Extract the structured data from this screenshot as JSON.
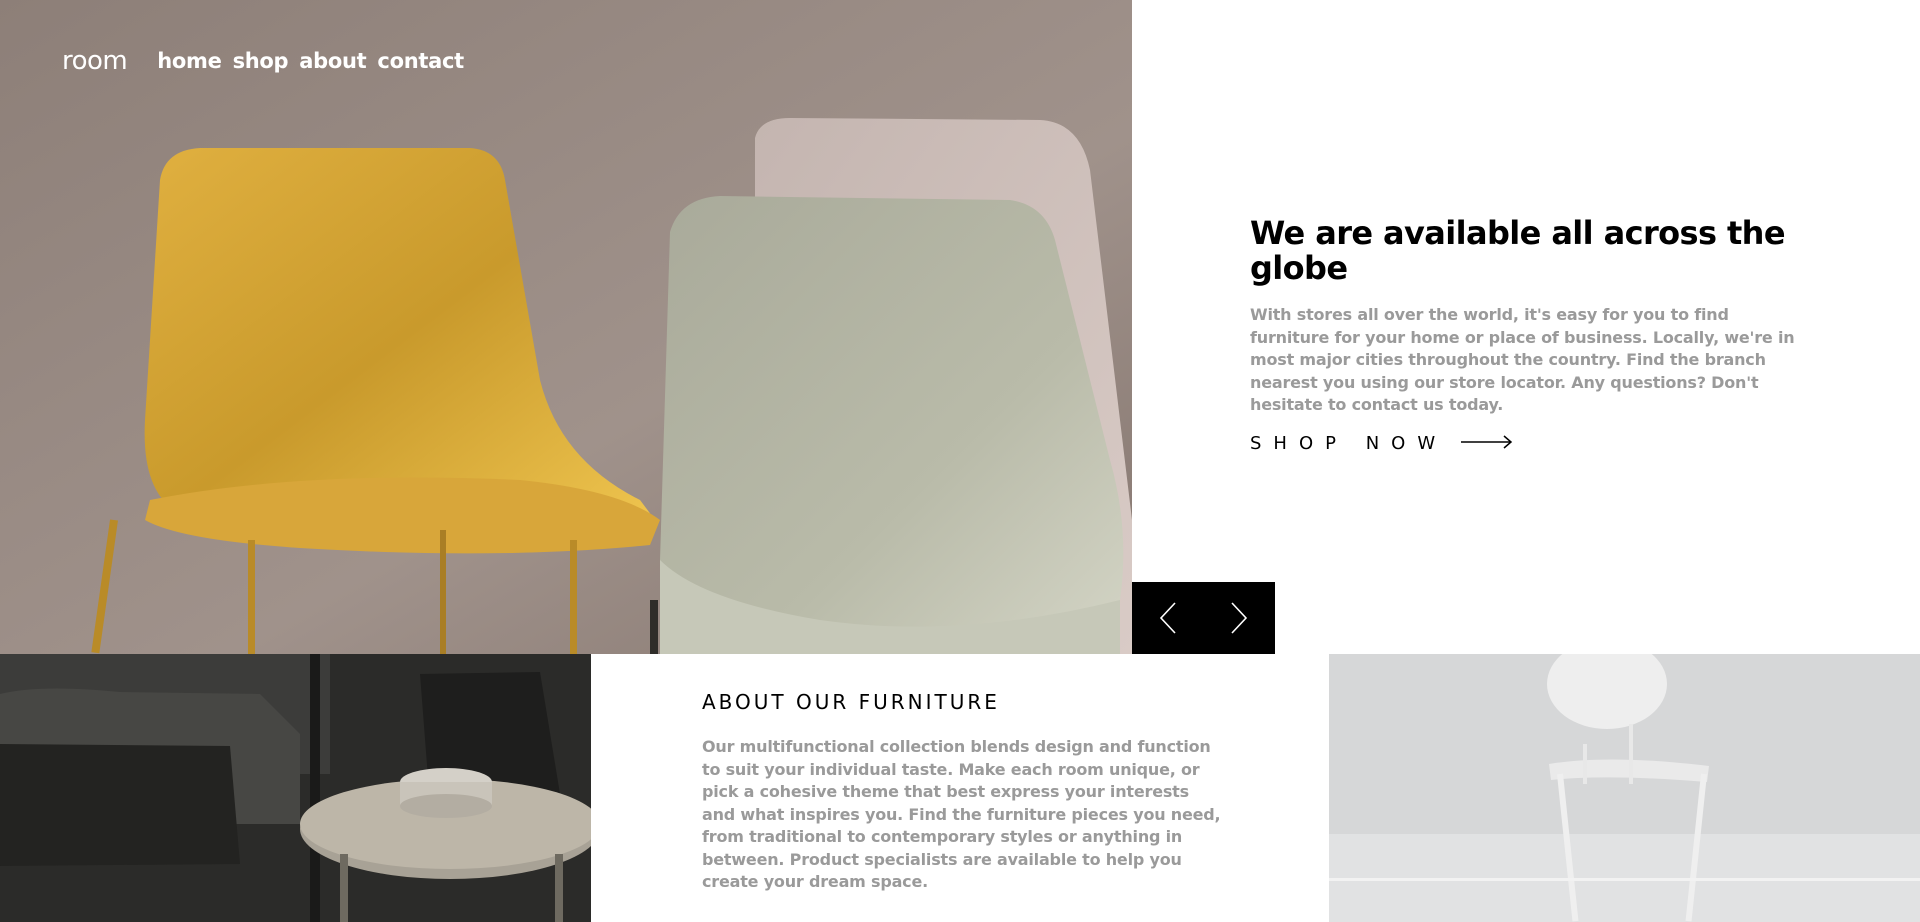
{
  "brand": {
    "logo": "room"
  },
  "nav": {
    "links": [
      "home",
      "shop",
      "about",
      "contact"
    ]
  },
  "hero": {
    "title": "We are available all across the globe",
    "description": "With stores all over the world, it's easy for you to find furniture for your home or place of business. Locally, we're in most major cities throughout the country. Find the branch nearest you using our store locator. Any questions? Don't hesitate to contact us today.",
    "cta_label": "SHOP NOW"
  },
  "slider": {
    "prev_icon": "chevron-left-icon",
    "next_icon": "chevron-right-icon"
  },
  "about": {
    "title": "ABOUT OUR FURNITURE",
    "description": "Our multifunctional collection blends design and function to suit your individual taste. Make each room unique, or pick a cohesive theme that best express your interests and what inspires you. Find the furniture pieces you need, from traditional to contemporary styles or anything in between. Product specialists are available to help you create your dream space."
  },
  "colors": {
    "accent_dark": "#000000",
    "muted_text": "#9a9a9a",
    "background": "#ffffff"
  }
}
